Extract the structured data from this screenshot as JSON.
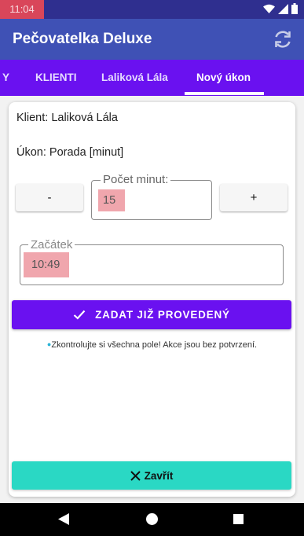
{
  "status": {
    "time": "11:04"
  },
  "app": {
    "title": "Pečovatelka Deluxe"
  },
  "tabs": [
    {
      "label": "Y"
    },
    {
      "label": "KLIENTI"
    },
    {
      "label": "Laliková Lála"
    },
    {
      "label": "Nový úkon"
    }
  ],
  "form": {
    "client": "Klient: Laliková Lála",
    "task": "Úkon: Porada [minut]",
    "minus_label": "-",
    "plus_label": "+",
    "minutes_label": "Počet minut:",
    "minutes_value": "15",
    "start_label": "Začátek",
    "start_value": "10:49",
    "submit_label": "ZADAT JIŽ PROVEDENÝ",
    "hint": "Zkontrolujte si všechna pole! Akce jsou bez potvrzení.",
    "close_label": "Zavřít"
  },
  "colors": {
    "appbar": "#3f51b5",
    "tabbar": "#6a11f0",
    "primary_button": "#6a11f0",
    "close_button": "#2ad8c4",
    "highlight": "#f0a6ad"
  },
  "icons": {
    "refresh": "refresh-icon",
    "check": "check-icon",
    "close": "close-icon",
    "wifi": "wifi-icon",
    "signal": "signal-icon",
    "battery": "battery-icon",
    "back": "back-icon",
    "home": "home-icon",
    "recent": "recent-apps-icon"
  }
}
